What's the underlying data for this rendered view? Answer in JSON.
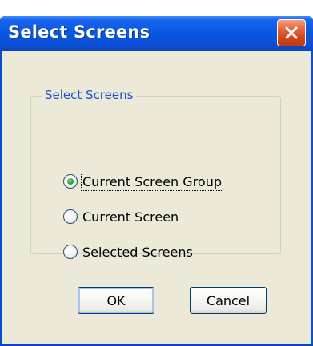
{
  "dialog": {
    "title": "Select Screens",
    "close_icon": "close-x-icon",
    "accent_color": "#0a58e2",
    "close_color": "#d2451a",
    "group": {
      "title": "Select Screens",
      "title_color": "#1f4fcf",
      "options": [
        {
          "label": "Current Screen Group",
          "selected": true
        },
        {
          "label": "Current Screen",
          "selected": false
        },
        {
          "label": "Selected Screens",
          "selected": false
        }
      ]
    },
    "buttons": {
      "ok_label": "OK",
      "cancel_label": "Cancel"
    }
  }
}
